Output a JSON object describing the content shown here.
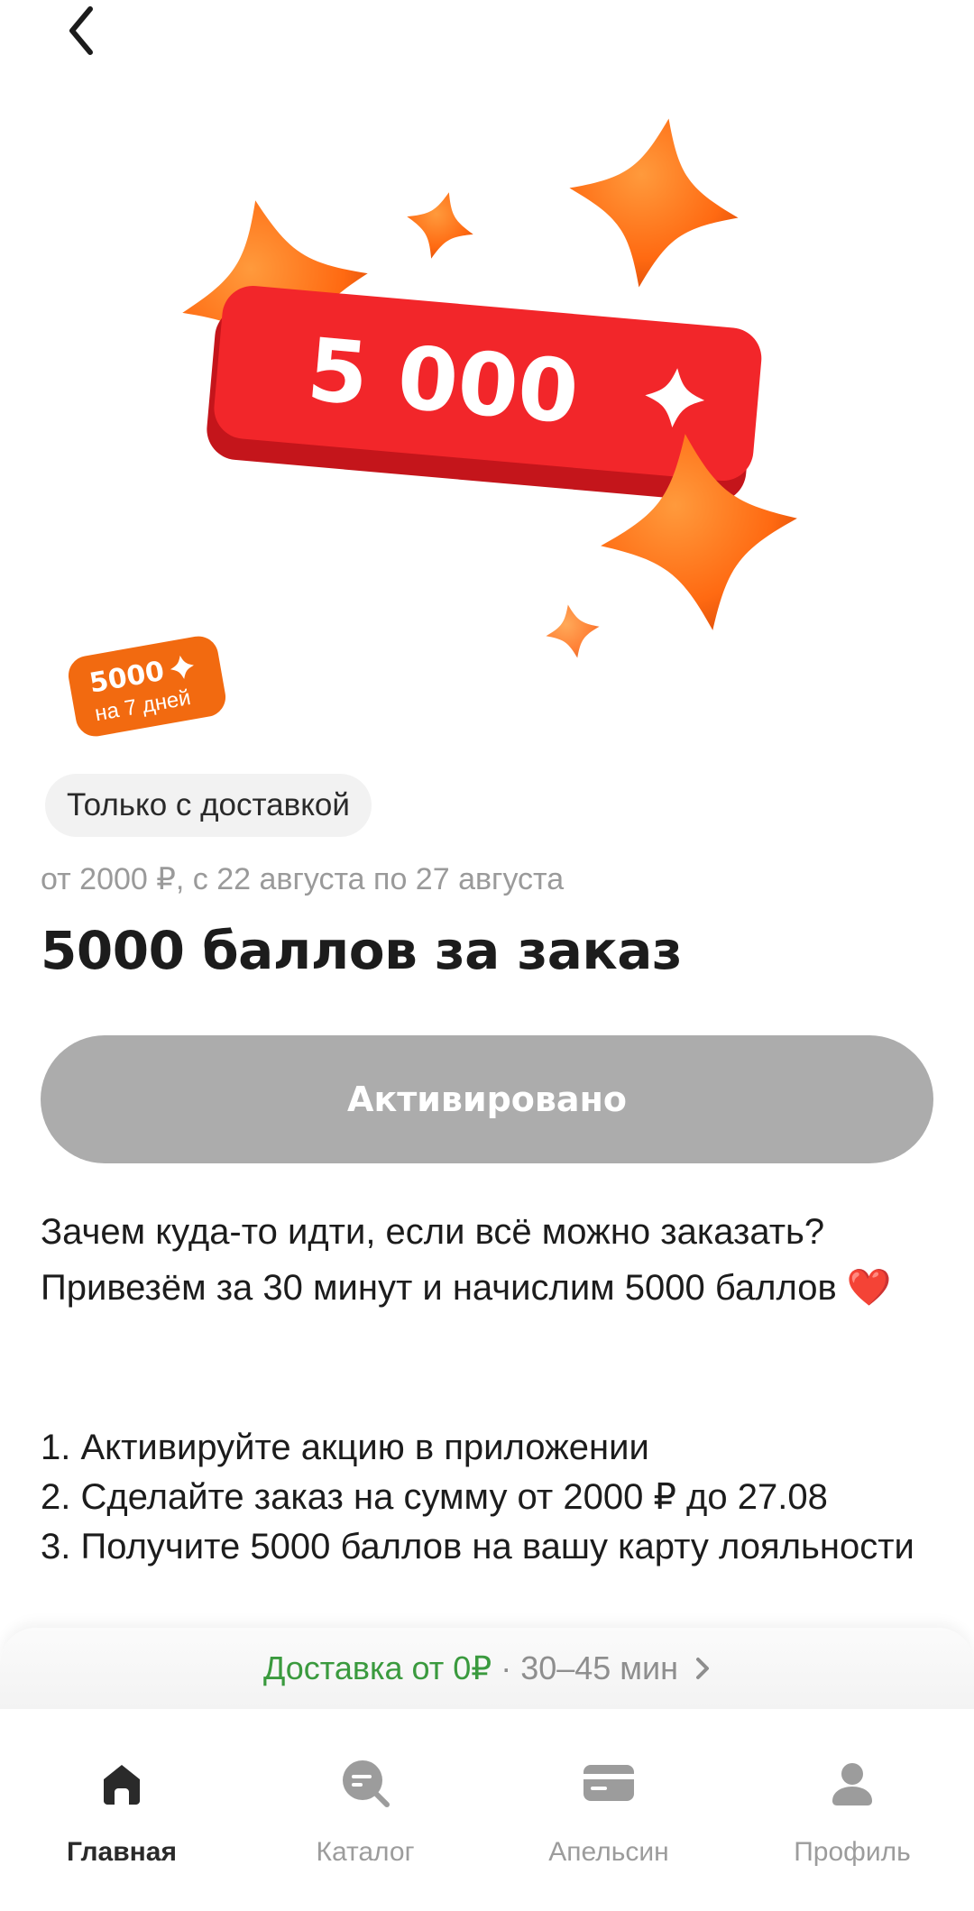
{
  "header": {
    "back_icon": "chevron-left-icon"
  },
  "hero": {
    "banner_text": "5 000",
    "sticker_points": "5000",
    "sticker_duration": "на 7 дней",
    "colors": {
      "banner": "#f2262a",
      "star": "#ff7a1a",
      "sticker": "#f26a10"
    }
  },
  "promo": {
    "chip_label": "Только с доставкой",
    "conditions": "от 2000 ₽, с 22 августа по 27 августа",
    "title": "5000 баллов за заказ",
    "button_label": "Активировано",
    "description": "Зачем куда-то идти, если всё можно заказать? Привезём за 30 минут и начислим 5000 баллов",
    "description_emoji": "❤️",
    "steps": [
      "1. Активируйте акцию в приложении",
      "2. Сделайте заказ на сумму от 2000 ₽ до 27.08",
      "3. Получите 5000 баллов на вашу карту лояльности"
    ]
  },
  "delivery_bar": {
    "price_text": "Доставка от 0₽",
    "separator": "·",
    "time_text": "30–45 мин"
  },
  "nav": {
    "items": [
      {
        "label": "Главная",
        "icon": "home-icon",
        "active": true
      },
      {
        "label": "Каталог",
        "icon": "catalog-search-icon",
        "active": false
      },
      {
        "label": "Апельсин",
        "icon": "card-icon",
        "active": false
      },
      {
        "label": "Профиль",
        "icon": "profile-icon",
        "active": false
      }
    ]
  }
}
